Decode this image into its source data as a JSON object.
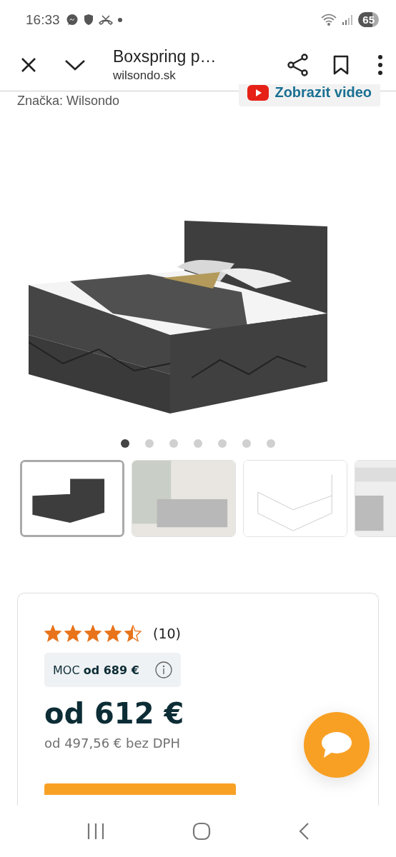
{
  "status_bar": {
    "time": "16:33",
    "battery": "65"
  },
  "browser_bar": {
    "title": "Boxspring p…",
    "url": "wilsondo.sk"
  },
  "product": {
    "brand": "Značka: Wilsondo",
    "video_button": "Zobrazit video",
    "gallery_dots": [
      {
        "selected": true
      },
      {
        "selected": false
      },
      {
        "selected": false
      },
      {
        "selected": false
      },
      {
        "selected": false
      },
      {
        "selected": false
      },
      {
        "selected": false
      }
    ],
    "thumbnails": [
      {
        "kind": "bed",
        "selected": true
      },
      {
        "kind": "room",
        "selected": false
      },
      {
        "kind": "sketch",
        "selected": false
      },
      {
        "kind": "detail",
        "selected": false
      }
    ]
  },
  "price_card": {
    "stars": 4.5,
    "review_count": "(10)",
    "moc": "MOC **od 689 €**",
    "price": "od 612 €",
    "price_without_vat": "od 497,56 € bez DPH"
  }
}
